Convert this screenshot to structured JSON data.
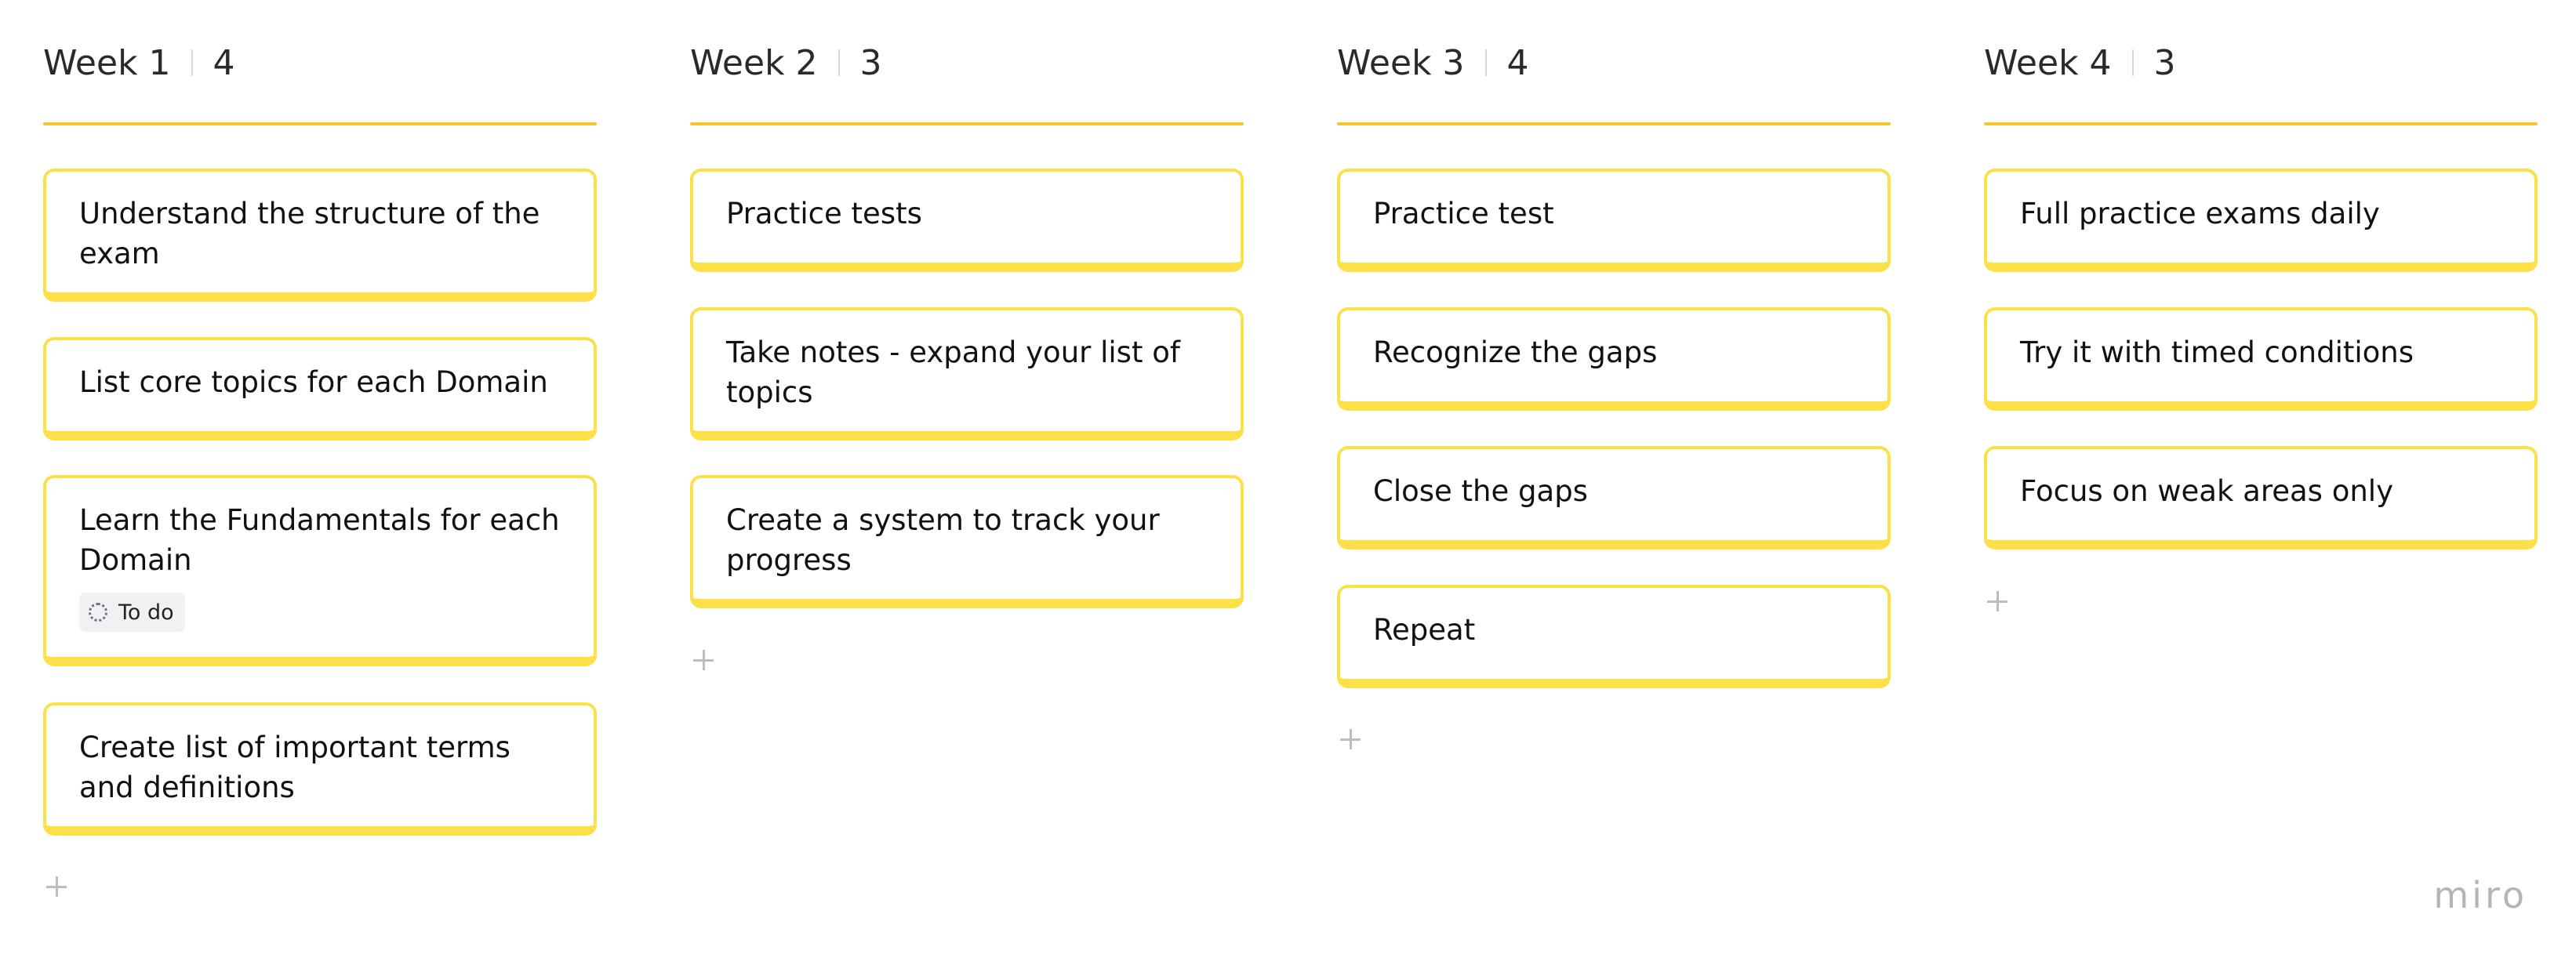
{
  "board": {
    "columns": [
      {
        "title": "Week 1",
        "count": "4",
        "cards": [
          {
            "text": "Understand the structure of the exam"
          },
          {
            "text": "List core topics for each Domain"
          },
          {
            "text": "Learn the Fundamentals for each Domain",
            "tag": "To do"
          },
          {
            "text": "Create list of important terms and definitions"
          }
        ]
      },
      {
        "title": "Week 2",
        "count": "3",
        "cards": [
          {
            "text": "Practice tests"
          },
          {
            "text": "Take notes - expand your list of topics"
          },
          {
            "text": "Create a system to track your progress"
          }
        ]
      },
      {
        "title": "Week 3",
        "count": "4",
        "cards": [
          {
            "text": "Practice test"
          },
          {
            "text": "Recognize the gaps"
          },
          {
            "text": "Close the gaps"
          },
          {
            "text": "Repeat"
          }
        ]
      },
      {
        "title": "Week 4",
        "count": "3",
        "cards": [
          {
            "text": "Full practice exams daily"
          },
          {
            "text": "Try it with timed conditions"
          },
          {
            "text": "Focus on weak areas only"
          }
        ]
      }
    ]
  },
  "logo_text": "miro",
  "colors": {
    "card_border": "#fde047",
    "column_rule": "#f5c52a",
    "tag_background": "#f1f1f3",
    "logo": "#b5b5b5"
  },
  "icons": {
    "add": "plus-icon",
    "status": "dotted-circle-icon"
  }
}
